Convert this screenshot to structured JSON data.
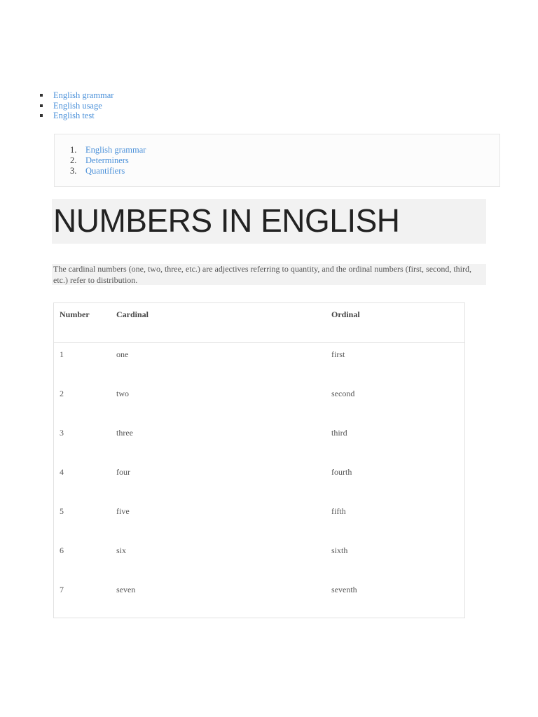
{
  "top_links": [
    "English grammar",
    "English usage",
    "English test"
  ],
  "breadcrumb": [
    {
      "num": "1.",
      "label": "English grammar"
    },
    {
      "num": "2.",
      "label": "Determiners"
    },
    {
      "num": "3.",
      "label": "Quantifiers"
    }
  ],
  "title": "NUMBERS IN ENGLISH",
  "intro": "The cardinal numbers (one, two, three, etc.) are adjectives referring to quantity, and the ordinal numbers (first, second, third, etc.) refer to distribution.",
  "table": {
    "headers": [
      "Number",
      "Cardinal",
      "Ordinal"
    ],
    "rows": [
      [
        "1",
        "one",
        "first"
      ],
      [
        "2",
        "two",
        "second"
      ],
      [
        "3",
        "three",
        "third"
      ],
      [
        "4",
        "four",
        "fourth"
      ],
      [
        "5",
        "five",
        "fifth"
      ],
      [
        "6",
        "six",
        "sixth"
      ],
      [
        "7",
        "seven",
        "seventh"
      ]
    ]
  }
}
